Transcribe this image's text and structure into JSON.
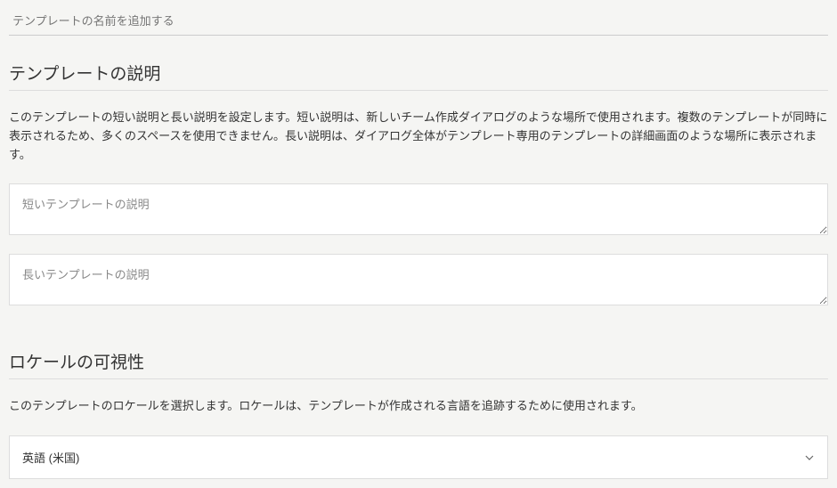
{
  "templateName": {
    "placeholder": "テンプレートの名前を追加する"
  },
  "descriptionSection": {
    "title": "テンプレートの説明",
    "helpText": "このテンプレートの短い説明と長い説明を設定します。短い説明は、新しいチーム作成ダイアログのような場所で使用されます。複数のテンプレートが同時に表示されるため、多くのスペースを使用できません。長い説明は、ダイアログ全体がテンプレート専用のテンプレートの詳細画面のような場所に表示されます。",
    "shortPlaceholder": "短いテンプレートの説明",
    "longPlaceholder": "長いテンプレートの説明"
  },
  "localeSection": {
    "title": "ロケールの可視性",
    "helpText": "このテンプレートのロケールを選択します。ロケールは、テンプレートが作成される言語を追跡するために使用されます。",
    "selectedLocale": "英語 (米国)"
  }
}
